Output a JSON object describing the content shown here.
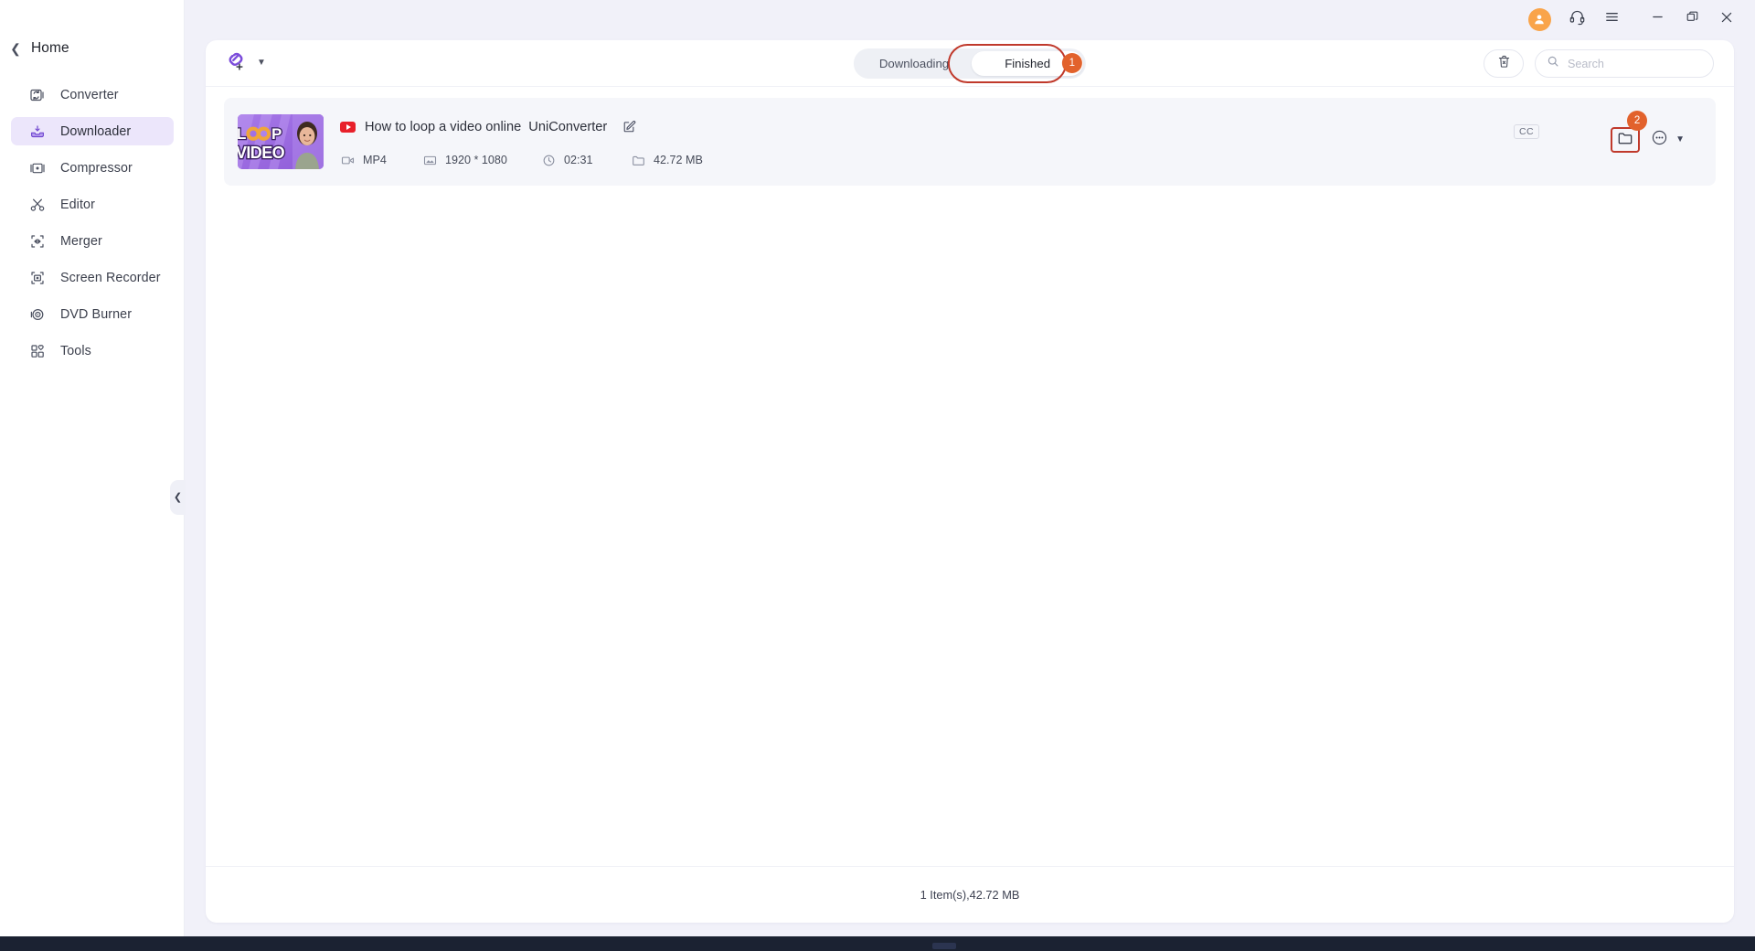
{
  "window": {
    "controls": [
      {
        "name": "account-avatar",
        "icon": "user-icon",
        "label": ""
      },
      {
        "name": "support-button",
        "icon": "headset-icon",
        "label": ""
      },
      {
        "name": "menu-button",
        "icon": "hamburger-icon",
        "label": ""
      },
      {
        "name": "minimize-button",
        "icon": "minimize-icon",
        "label": ""
      },
      {
        "name": "maximize-button",
        "icon": "maximize-icon",
        "label": ""
      },
      {
        "name": "close-button",
        "icon": "close-icon",
        "label": ""
      }
    ]
  },
  "sidebar": {
    "back_label": "Home",
    "back_icon": "chevron-left-icon",
    "collapse_icon": "chevron-left-icon",
    "items": [
      {
        "label": "Converter",
        "icon": "converter-icon",
        "active": false
      },
      {
        "label": "Downloader",
        "icon": "downloader-icon",
        "active": true
      },
      {
        "label": "Compressor",
        "icon": "compressor-icon",
        "active": false
      },
      {
        "label": "Editor",
        "icon": "scissors-icon",
        "active": false
      },
      {
        "label": "Merger",
        "icon": "merger-icon",
        "active": false
      },
      {
        "label": "Screen Recorder",
        "icon": "screen-recorder-icon",
        "active": false
      },
      {
        "label": "DVD Burner",
        "icon": "dvd-burner-icon",
        "active": false
      },
      {
        "label": "Tools",
        "icon": "tools-grid-icon",
        "active": false
      }
    ]
  },
  "toolbar": {
    "paste_link_icon": "link-plus-icon",
    "paste_link_chevron": "chevron-down-icon",
    "chevron_glyph": "⌄",
    "tabs": [
      {
        "label": "Downloading",
        "selected": false
      },
      {
        "label": "Finished",
        "selected": true
      }
    ],
    "tab_badge": "1",
    "trash_icon": "trash-x-icon",
    "search": {
      "icon": "search-icon",
      "value": "",
      "placeholder": "Search"
    }
  },
  "list": {
    "items": [
      {
        "source_icon": "youtube-icon",
        "title": "How to loop a video online  UniConverter",
        "edit_icon": "edit-pencil-icon",
        "thumbnail_text_top": "LOOP",
        "thumbnail_text_bottom": "VIDEO",
        "caption_badge": "CC",
        "action_badge": "2",
        "folder_icon": "folder-icon",
        "more_icon": "more-dots-icon",
        "more_chevron": "chevron-down-icon",
        "meta": [
          {
            "icon": "video-format-icon",
            "value": "MP4"
          },
          {
            "icon": "resolution-icon",
            "value": "1920 * 1080"
          },
          {
            "icon": "clock-icon",
            "value": "02:31"
          },
          {
            "icon": "file-size-icon",
            "value": "42.72 MB"
          }
        ]
      }
    ]
  },
  "footer": {
    "summary": "1 Item(s),42.72 MB"
  },
  "colors": {
    "accent_purple": "#7c4ddb",
    "active_nav_bg": "#ece6fb",
    "badge_orange": "#e2622c",
    "highlight_red": "#c0392b",
    "app_bg": "#f1f1f9",
    "row_bg": "#f5f6fa",
    "avatar_orange": "#f9a44a",
    "youtube_red": "#e8202a"
  }
}
